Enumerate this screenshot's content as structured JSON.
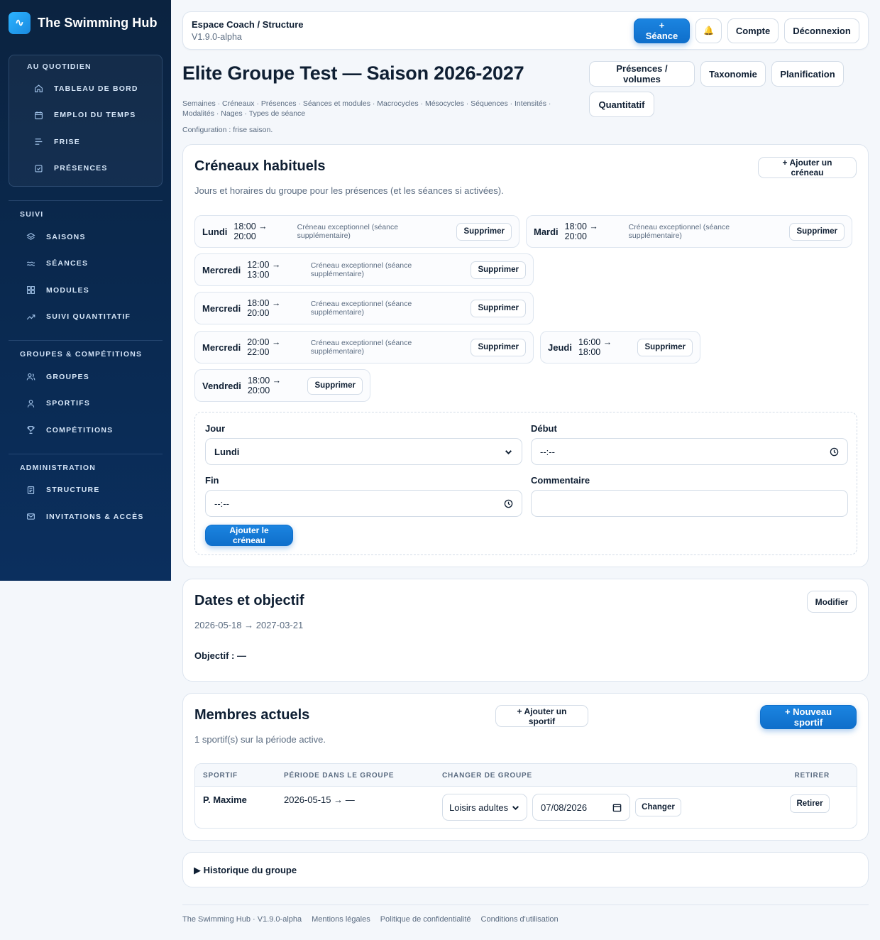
{
  "brand": {
    "name": "The Swimming Hub",
    "logo_glyph": "∿"
  },
  "sidebar": {
    "quotidien": {
      "title": "Au quotidien",
      "items": [
        {
          "label": "Tableau de bord",
          "icon": "home-icon"
        },
        {
          "label": "Emploi du temps",
          "icon": "calendar-icon"
        },
        {
          "label": "Frise",
          "icon": "timeline-icon"
        },
        {
          "label": "Présences",
          "icon": "checkbox-icon"
        }
      ]
    },
    "suivi": {
      "title": "Suivi",
      "items": [
        {
          "label": "Saisons",
          "icon": "layers-icon"
        },
        {
          "label": "Séances",
          "icon": "waves-icon"
        },
        {
          "label": "Modules",
          "icon": "grid-icon"
        },
        {
          "label": "Suivi quantitatif",
          "icon": "trending-up-icon"
        }
      ]
    },
    "groupes": {
      "title": "Groupes & compétitions",
      "items": [
        {
          "label": "Groupes",
          "icon": "users-icon"
        },
        {
          "label": "Sportifs",
          "icon": "user-icon"
        },
        {
          "label": "Compétitions",
          "icon": "trophy-icon"
        }
      ]
    },
    "admin": {
      "title": "Administration",
      "items": [
        {
          "label": "Structure",
          "icon": "document-icon"
        },
        {
          "label": "Invitations & accès",
          "icon": "mail-icon"
        }
      ]
    }
  },
  "header": {
    "title": "Espace Coach / Structure",
    "version": "V1.9.0-alpha",
    "seance_label": "+ Séance",
    "bell_glyph": "🔔",
    "account_label": "Compte",
    "logout_label": "Déconnexion"
  },
  "page": {
    "title": "Elite Groupe Test — Saison 2026-2027",
    "links": "Semaines · Créneaux · Présences · Séances et modules · Macrocycles · Mésocycles · Séquences · Intensités · Modalités · Nages · Types de séance",
    "config": "Configuration : frise saison.",
    "actions": [
      "Présences / volumes",
      "Taxonomie",
      "Planification",
      "Quantitatif"
    ]
  },
  "creneaux": {
    "title": "Créneaux habituels",
    "subtitle": "Jours et horaires du groupe pour les présences (et les séances si activées).",
    "add_label": "+ Ajouter un créneau",
    "delete_label": "Supprimer",
    "slots": [
      {
        "day": "Lundi",
        "time": "18:00 → 20:00",
        "note": "Créneau exceptionnel (séance supplémentaire)"
      },
      {
        "day": "Mardi",
        "time": "18:00 → 20:00",
        "note": "Créneau exceptionnel (séance supplémentaire)"
      },
      {
        "day": "Mercredi",
        "time": "12:00 → 13:00",
        "note": "Créneau exceptionnel (séance supplémentaire)"
      },
      {
        "day": "Mercredi",
        "time": "18:00 → 20:00",
        "note": "Créneau exceptionnel (séance supplémentaire)"
      },
      {
        "day": "Mercredi",
        "time": "20:00 → 22:00",
        "note": "Créneau exceptionnel (séance supplémentaire)"
      },
      {
        "day": "Jeudi",
        "time": "16:00 → 18:00",
        "note": ""
      },
      {
        "day": "Vendredi",
        "time": "18:00 → 20:00",
        "note": ""
      }
    ],
    "form": {
      "jour_label": "Jour",
      "jour_value": "Lundi",
      "debut_label": "Début",
      "debut_value": "--:--",
      "fin_label": "Fin",
      "fin_value": "--:--",
      "comment_label": "Commentaire",
      "comment_value": "",
      "submit_label": "Ajouter le créneau"
    }
  },
  "dates": {
    "title": "Dates et objectif",
    "modify_label": "Modifier",
    "range": "2026-05-18 → 2027-03-21",
    "objective": "Objectif : —"
  },
  "membres": {
    "title": "Membres actuels",
    "subtitle": "1 sportif(s) sur la période active.",
    "add_label": "+ Ajouter un sportif",
    "new_label": "+ Nouveau sportif",
    "columns": [
      "Sportif",
      "Période dans le groupe",
      "Changer de groupe",
      "Retirer"
    ],
    "rows": [
      {
        "name": "P. Maxime",
        "period": "2026-05-15 → —",
        "group": "Loisirs adultes",
        "date": "07/08/2026",
        "change_label": "Changer",
        "remove_label": "Retirer"
      }
    ]
  },
  "historique": {
    "label": "▶  Historique du groupe"
  },
  "footer": {
    "items": [
      "The Swimming Hub · V1.9.0-alpha",
      "Mentions légales",
      "Politique de confidentialité",
      "Conditions d'utilisation"
    ]
  },
  "colors": {
    "primary": "#1177d6",
    "sidebar": "#0b2340",
    "border": "#dde5ef"
  }
}
